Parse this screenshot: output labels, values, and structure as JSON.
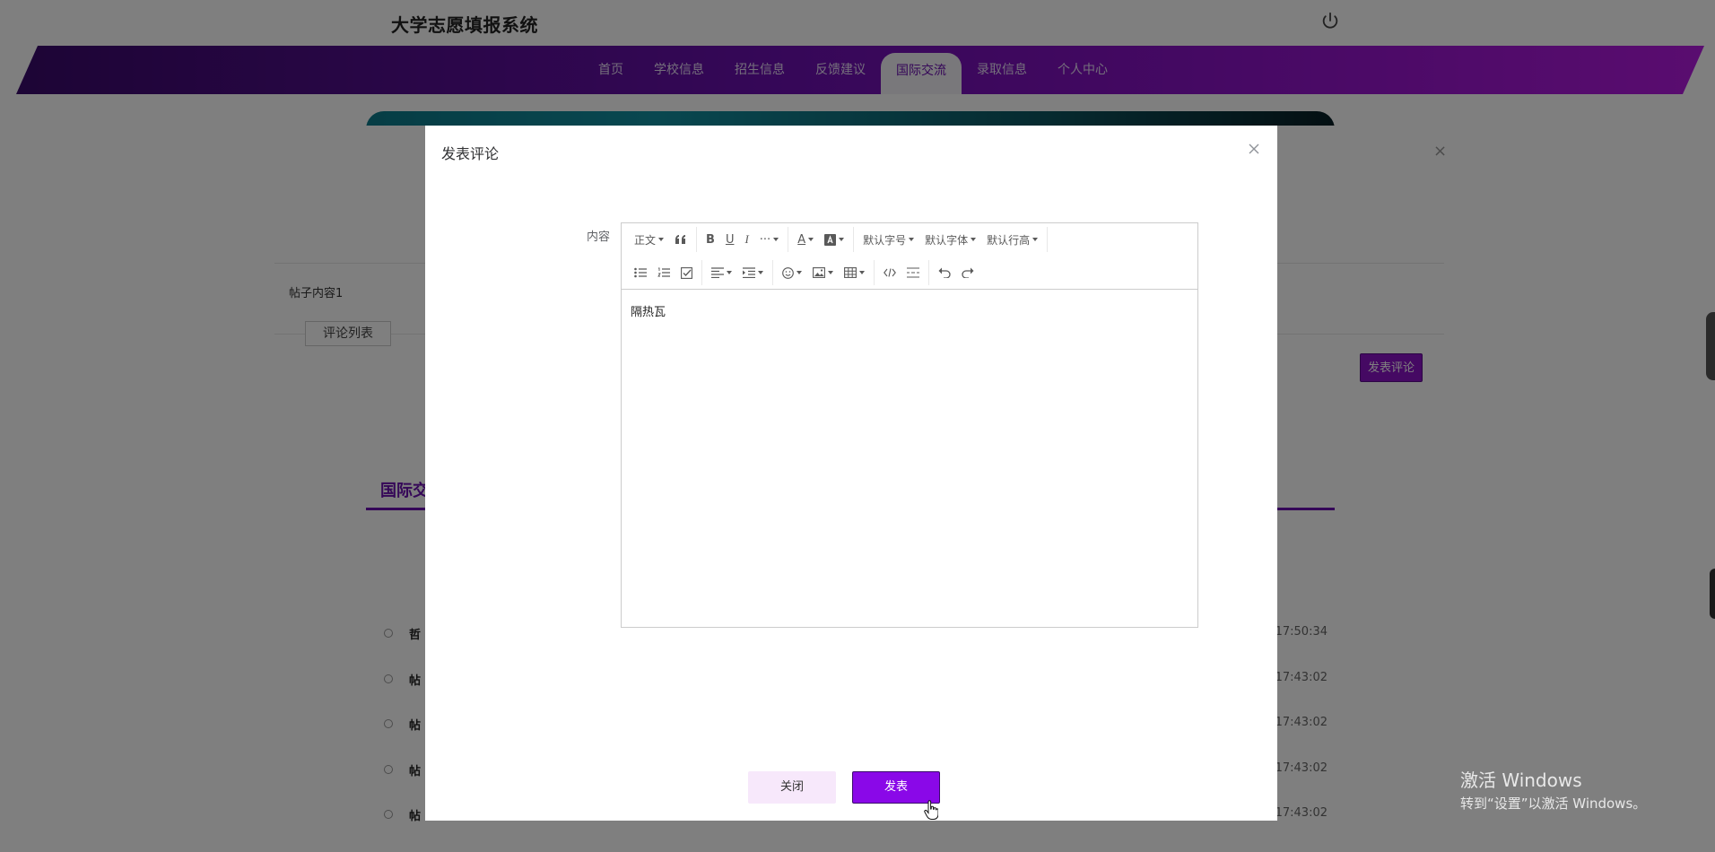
{
  "site": {
    "title": "大学志愿填报系统"
  },
  "nav": {
    "items": [
      "首页",
      "学校信息",
      "招生信息",
      "反馈建议",
      "国际交流",
      "录取信息",
      "个人中心"
    ],
    "active_index": 4
  },
  "section": {
    "title": "国际交"
  },
  "posts": [
    {
      "title": "哲",
      "time": "17:50:34"
    },
    {
      "title": "帖",
      "time": "17:43:02"
    },
    {
      "title": "帖",
      "time": "17:43:02"
    },
    {
      "title": "帖",
      "time": "17:43:02"
    },
    {
      "title": "帖",
      "time": "17:43:02"
    }
  ],
  "bg_modal": {
    "content": "帖子内容1",
    "tab_label": "评论列表",
    "publish_label": "发表评论"
  },
  "dialog": {
    "title": "发表评论",
    "field_label": "内容",
    "toolbar": {
      "heading": "正文",
      "font_size": "默认字号",
      "font_family": "默认字体",
      "line_height": "默认行高"
    },
    "content": "隔热瓦",
    "close_label": "关闭",
    "submit_label": "发表"
  },
  "watermark": {
    "line1": "激活 Windows",
    "line2": "转到“设置”以激活 Windows。"
  },
  "colors": {
    "accent": "#8a08e8",
    "nav_dark": "#3a0a6b"
  }
}
